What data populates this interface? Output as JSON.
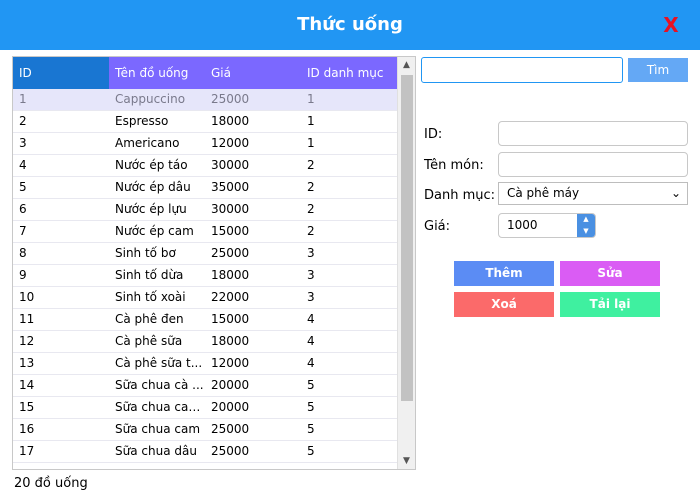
{
  "window": {
    "title": "Thức uống",
    "close_label": "X"
  },
  "table": {
    "headers": [
      "ID",
      "Tên đồ uống",
      "Giá",
      "ID danh mục"
    ],
    "rows": [
      [
        "1",
        "Cappuccino",
        "25000",
        "1"
      ],
      [
        "2",
        "Espresso",
        "18000",
        "1"
      ],
      [
        "3",
        "Americano",
        "12000",
        "1"
      ],
      [
        "4",
        "Nước ép táo",
        "30000",
        "2"
      ],
      [
        "5",
        "Nước ép dâu",
        "35000",
        "2"
      ],
      [
        "6",
        "Nước ép lựu",
        "30000",
        "2"
      ],
      [
        "7",
        "Nước ép cam",
        "15000",
        "2"
      ],
      [
        "8",
        "Sinh tố bơ",
        "25000",
        "3"
      ],
      [
        "9",
        "Sinh tố dừa",
        "18000",
        "3"
      ],
      [
        "10",
        "Sinh tố xoài",
        "22000",
        "3"
      ],
      [
        "11",
        "Cà phê đen",
        "15000",
        "4"
      ],
      [
        "12",
        "Cà phê sữa",
        "18000",
        "4"
      ],
      [
        "13",
        "Cà phê sữa t...",
        "12000",
        "4"
      ],
      [
        "14",
        "Sữa chua cà ...",
        "20000",
        "5"
      ],
      [
        "15",
        "Sữa chua cac...",
        "20000",
        "5"
      ],
      [
        "16",
        "Sữa chua cam",
        "25000",
        "5"
      ],
      [
        "17",
        "Sữa chua dâu",
        "25000",
        "5"
      ]
    ],
    "selected_row": 0
  },
  "status": {
    "count_label": "20 đồ uống"
  },
  "search": {
    "value": "",
    "button_label": "Tìm"
  },
  "form": {
    "id_label": "ID:",
    "id_value": "",
    "name_label": "Tên món:",
    "name_value": "",
    "category_label": "Danh mục:",
    "category_value": "Cà phê máy",
    "price_label": "Giá:",
    "price_value": "1000"
  },
  "buttons": {
    "add": "Thêm",
    "edit": "Sửa",
    "delete": "Xoá",
    "reload": "Tải lại"
  },
  "colors": {
    "titlebar": "#2196f3",
    "close": "#e81123",
    "add": "#5b8cf4",
    "edit": "#da5cf4",
    "delete": "#fb6a6a",
    "reload": "#3ff0a0"
  },
  "icons": {
    "close": "close-icon",
    "scroll_up": "chevron-up-icon",
    "scroll_down": "chevron-down-icon",
    "select_arrow": "chevron-down-icon"
  }
}
